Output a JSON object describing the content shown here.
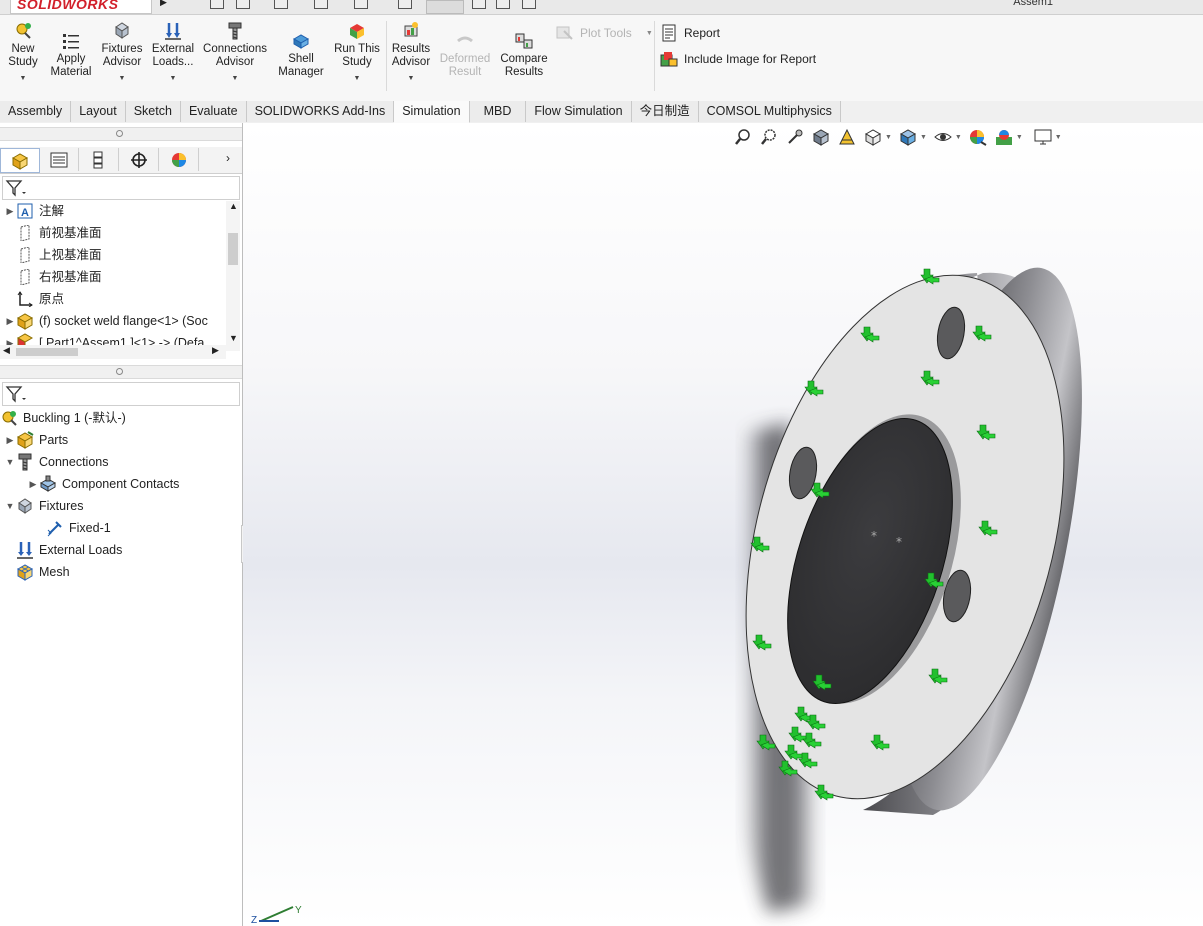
{
  "app": {
    "logo_text": "SOLIDWORKS",
    "doc_title": "Assem1"
  },
  "ribbon": {
    "buttons": [
      {
        "label1": "New",
        "label2": "Study",
        "icon": "new-study-icon"
      },
      {
        "label1": "Apply",
        "label2": "Material",
        "icon": "apply-material-icon"
      },
      {
        "label1": "Fixtures",
        "label2": "Advisor",
        "icon": "fixtures-advisor-icon"
      },
      {
        "label1": "External",
        "label2": "Loads...",
        "icon": "external-loads-icon"
      },
      {
        "label1": "Connections",
        "label2": "Advisor",
        "icon": "connections-advisor-icon"
      },
      {
        "label1": "Shell",
        "label2": "Manager",
        "icon": "shell-manager-icon"
      },
      {
        "label1": "Run This",
        "label2": "Study",
        "icon": "run-study-icon"
      },
      {
        "label1": "Results",
        "label2": "Advisor",
        "icon": "results-advisor-icon"
      },
      {
        "label1": "Deformed",
        "label2": "Result",
        "icon": "deformed-result-icon"
      },
      {
        "label1": "Compare",
        "label2": "Results",
        "icon": "compare-results-icon"
      }
    ],
    "plot_tools": "Plot Tools",
    "report": "Report",
    "include_image": "Include Image for Report"
  },
  "tabs": [
    "Assembly",
    "Layout",
    "Sketch",
    "Evaluate",
    "SOLIDWORKS Add-Ins",
    "Simulation",
    "MBD",
    "Flow Simulation",
    "今日制造",
    "COMSOL Multiphysics"
  ],
  "active_tab": "Simulation",
  "feature_tree": [
    {
      "label": "注解",
      "expand": "▶"
    },
    {
      "label": "前视基准面",
      "expand": ""
    },
    {
      "label": "上视基准面",
      "expand": ""
    },
    {
      "label": "右视基准面",
      "expand": ""
    },
    {
      "label": "原点",
      "expand": ""
    },
    {
      "label": "(f) socket weld flange<1> (Soc",
      "expand": "▶"
    },
    {
      "label": "[ Part1^Assem1 ]<1> -> (Defa",
      "expand": "▶"
    }
  ],
  "sim_tree": [
    {
      "label": "Buckling 1 (-默认-)",
      "expand": ""
    },
    {
      "label": "Parts",
      "expand": "▶"
    },
    {
      "label": "Connections",
      "expand": "▼"
    },
    {
      "label": "Component Contacts",
      "expand": "▶"
    },
    {
      "label": "Fixtures",
      "expand": "▼"
    },
    {
      "label": "Fixed-1",
      "expand": ""
    },
    {
      "label": "External Loads",
      "expand": ""
    },
    {
      "label": "Mesh",
      "expand": ""
    }
  ],
  "colors": {
    "accent": "#1f5fae",
    "fixture_arrow": "#22c02e",
    "flange_face": "#e3e3e3",
    "flange_rim": "#6e6e72"
  }
}
